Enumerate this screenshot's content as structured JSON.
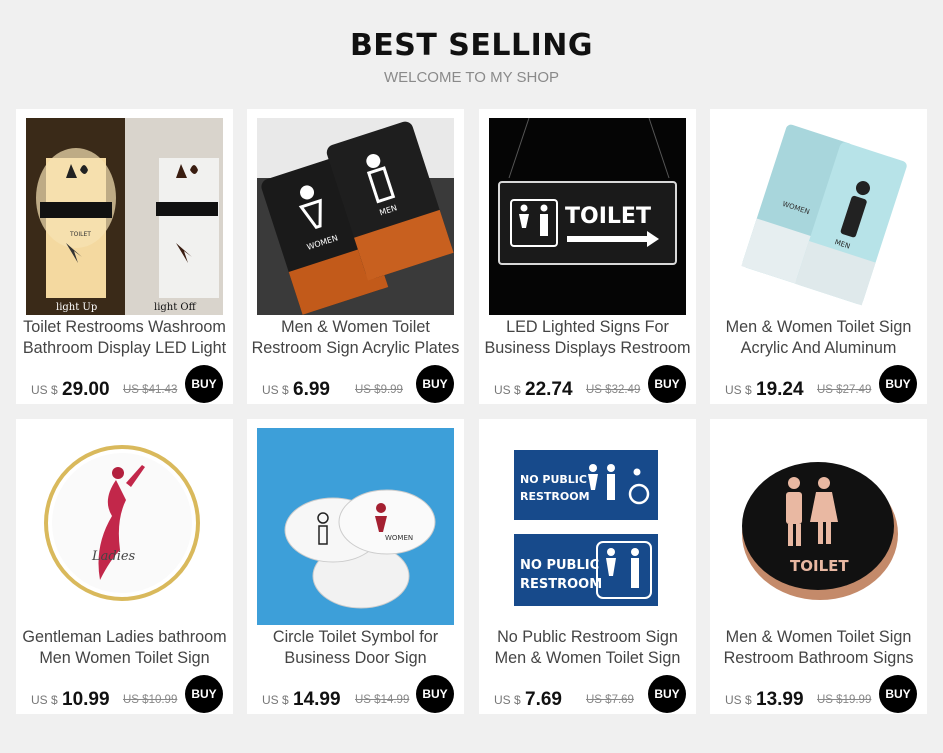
{
  "header": {
    "title": "BEST SELLING",
    "subtitle": "WELCOME TO MY SHOP"
  },
  "products": [
    {
      "title1": "Toilet Restrooms Washroom",
      "title2": "Bathroom Display LED Light",
      "currency": "US $",
      "price": "29.00",
      "old_price": "US $41.43",
      "buy": "BUY",
      "img_text1": "light Up",
      "img_text2": "light Off",
      "img_text3": "TOILET"
    },
    {
      "title1": "Men & Women Toilet",
      "title2": "Restroom Sign Acrylic Plates",
      "currency": "US $",
      "price": "6.99",
      "old_price": "US $9.99",
      "buy": "BUY",
      "img_text1": "WOMEN",
      "img_text2": "MEN"
    },
    {
      "title1": "LED Lighted Signs For",
      "title2": "Business Displays Restroom",
      "currency": "US $",
      "price": "22.74",
      "old_price": "US $32.49",
      "buy": "BUY",
      "img_text1": "TOILET"
    },
    {
      "title1": "Men & Women Toilet Sign",
      "title2": "Acrylic And Aluminum",
      "currency": "US $",
      "price": "19.24",
      "old_price": "US $27.49",
      "buy": "BUY",
      "img_text1": "WOMEN",
      "img_text2": "MEN"
    },
    {
      "title1": "Gentleman Ladies bathroom",
      "title2": "Men Women Toilet Sign",
      "currency": "US $",
      "price": "10.99",
      "old_price": "US $10.99",
      "buy": "BUY",
      "img_text1": "Ladies"
    },
    {
      "title1": "Circle Toilet Symbol for",
      "title2": "Business Door Sign",
      "currency": "US $",
      "price": "14.99",
      "old_price": "US $14.99",
      "buy": "BUY",
      "img_text1": "WOMEN"
    },
    {
      "title1": "No Public Restroom Sign",
      "title2": "Men & Women Toilet Sign",
      "currency": "US $",
      "price": "7.69",
      "old_price": "US $7.69",
      "buy": "BUY",
      "img_text1": "NO PUBLIC",
      "img_text2": "RESTROOM"
    },
    {
      "title1": "Men & Women Toilet Sign",
      "title2": "Restroom Bathroom Signs",
      "currency": "US $",
      "price": "13.99",
      "old_price": "US $19.99",
      "buy": "BUY",
      "img_text1": "TOILET"
    }
  ]
}
